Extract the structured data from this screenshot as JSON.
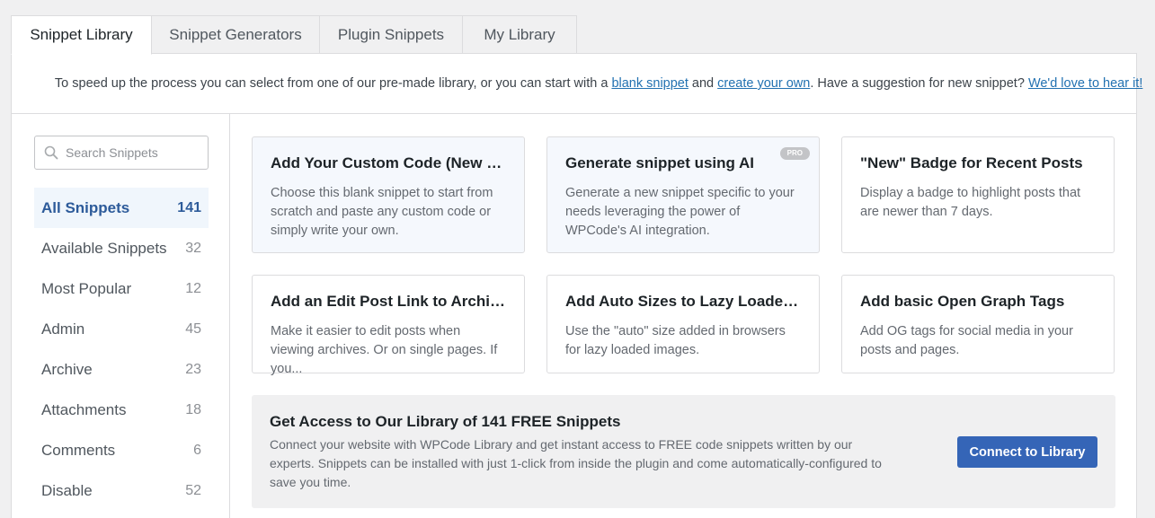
{
  "tabs": [
    {
      "label": "Snippet Library"
    },
    {
      "label": "Snippet Generators"
    },
    {
      "label": "Plugin Snippets"
    },
    {
      "label": "My Library"
    }
  ],
  "intro": {
    "text_1": "To speed up the process you can select from one of our pre-made library, or you can start with a ",
    "link_blank": "blank snippet",
    "text_2": " and ",
    "link_create": "create your own",
    "text_3": ". Have a suggestion for new snippet? ",
    "link_suggest": "We'd love to hear it!"
  },
  "search": {
    "placeholder": "Search Snippets"
  },
  "categories": [
    {
      "label": "All Snippets",
      "count": "141"
    },
    {
      "label": "Available Snippets",
      "count": "32"
    },
    {
      "label": "Most Popular",
      "count": "12"
    },
    {
      "label": "Admin",
      "count": "45"
    },
    {
      "label": "Archive",
      "count": "23"
    },
    {
      "label": "Attachments",
      "count": "18"
    },
    {
      "label": "Comments",
      "count": "6"
    },
    {
      "label": "Disable",
      "count": "52"
    }
  ],
  "cards": [
    {
      "title": "Add Your Custom Code (New Snippet)",
      "desc": "Choose this blank snippet to start from scratch and paste any custom code or simply write your own."
    },
    {
      "title": "Generate snippet using AI",
      "desc": "Generate a new snippet specific to your needs leveraging the power of WPCode's AI integration.",
      "badge": "PRO"
    },
    {
      "title": "\"New\" Badge for Recent Posts",
      "desc": "Display a badge to highlight posts that are newer than 7 days."
    },
    {
      "title": "Add an Edit Post Link to Archives",
      "desc": "Make it easier to edit posts when viewing archives. Or on single pages. If you..."
    },
    {
      "title": "Add Auto Sizes to Lazy Loaded images",
      "desc": "Use the \"auto\" size added in browsers for lazy loaded images."
    },
    {
      "title": "Add basic Open Graph Tags",
      "desc": "Add OG tags for social media in your posts and pages."
    }
  ],
  "cta": {
    "title": "Get Access to Our Library of 141 FREE Snippets",
    "desc": "Connect your website with WPCode Library and get instant access to FREE code snippets written by our experts. Snippets can be installed with just 1-click from inside the plugin and come automatically-configured to save you time.",
    "button": "Connect to Library"
  },
  "colors": {
    "accent": "#3565b7",
    "link": "#2271b1",
    "active_bg": "#f0f6fc"
  }
}
